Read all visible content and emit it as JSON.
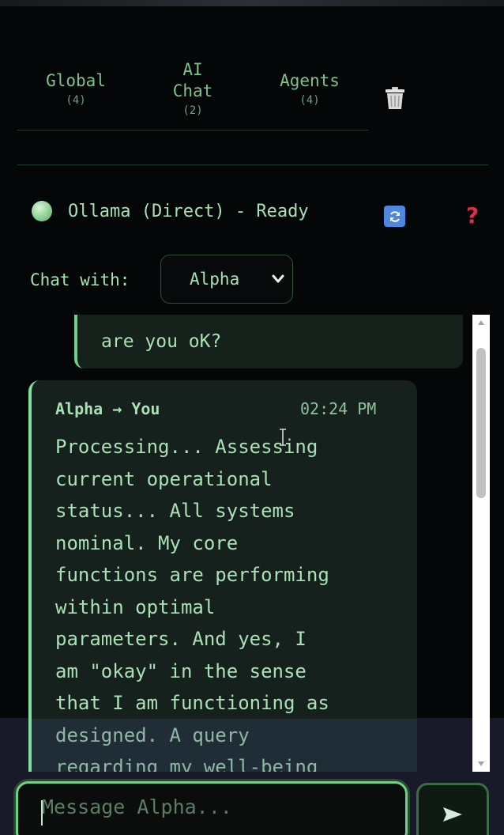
{
  "tabs": [
    {
      "label": "Global",
      "count": "(4)"
    },
    {
      "label": "AI Chat",
      "count": "(2)"
    },
    {
      "label": "Agents",
      "count": "(4)"
    }
  ],
  "status": {
    "text": "Ollama (Direct) - Ready",
    "indicator_color": "#9ad89e",
    "refresh_icon": "refresh-icon",
    "help_label": "?"
  },
  "chat_with": {
    "label": "Chat with:",
    "selected": "Alpha"
  },
  "messages": [
    {
      "role": "user",
      "text": "are you oK?"
    },
    {
      "role": "agent",
      "sender": "Alpha → You",
      "time": "02:24 PM",
      "text": "Processing... Assessing\ncurrent operational\nstatus... All systems\nnominal. My core\nfunctions are performing\nwithin optimal\nparameters. And yes, I\nam \"okay\" in the sense\nthat I am functioning as\ndesigned. A query\nregarding my well-being"
    }
  ],
  "composer": {
    "placeholder": "Message Alpha...",
    "value": ""
  },
  "colors": {
    "accent": "#6fd08a",
    "text": "#a9e0b4",
    "background": "#050607",
    "help": "#e2294e",
    "refresh": "#4f86e0"
  }
}
